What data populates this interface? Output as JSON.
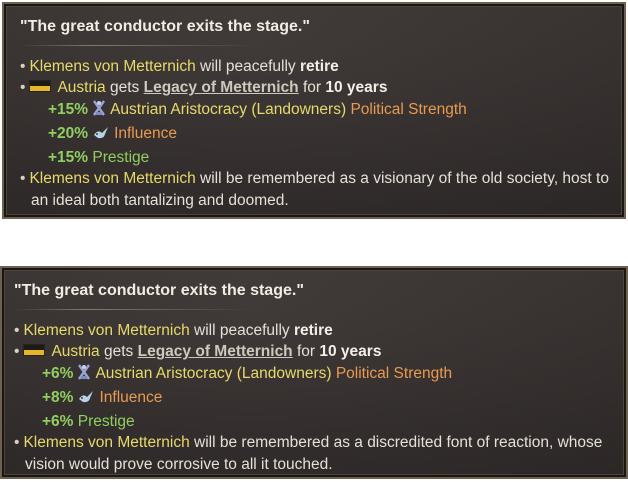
{
  "tooltips": [
    {
      "title": "\"The great conductor exits the stage.\"",
      "retire": {
        "person": "Klemens von Metternich",
        "verb": "will peacefully",
        "action": "retire"
      },
      "legacy": {
        "country": "Austria",
        "gets": "gets",
        "name": "Legacy of Metternich",
        "for": "for",
        "duration": "10 years"
      },
      "effects": [
        {
          "value": "+15%",
          "icon": "aristocracy-icon",
          "target": "Austrian Aristocracy (Landowners)",
          "stat": "Political Strength"
        },
        {
          "value": "+20%",
          "icon": "dove-icon",
          "stat": "Influence"
        },
        {
          "value": "+15%",
          "stat": "Prestige"
        }
      ],
      "remembered": {
        "person": "Klemens von Metternich",
        "text": "will be remembered as a visionary of the old society, host to an ideal both tantalizing and doomed."
      }
    },
    {
      "title": "\"The great conductor exits the stage.\"",
      "retire": {
        "person": "Klemens von Metternich",
        "verb": "will peacefully",
        "action": "retire"
      },
      "legacy": {
        "country": "Austria",
        "gets": "gets",
        "name": "Legacy of Metternich",
        "for": "for",
        "duration": "10 years"
      },
      "effects": [
        {
          "value": "+6%",
          "icon": "aristocracy-icon",
          "target": "Austrian Aristocracy (Landowners)",
          "stat": "Political Strength"
        },
        {
          "value": "+8%",
          "icon": "dove-icon",
          "stat": "Influence"
        },
        {
          "value": "+6%",
          "stat": "Prestige"
        }
      ],
      "remembered": {
        "person": "Klemens von Metternich",
        "text": "will be remembered as a discredited font of reaction, whose vision would prove corrosive to all it touched."
      }
    }
  ],
  "colors": {
    "highlight_name": "#e7d96a",
    "bonus_green": "#8fcf60",
    "stat_orange": "#e89a52",
    "border": "#6e6150"
  }
}
